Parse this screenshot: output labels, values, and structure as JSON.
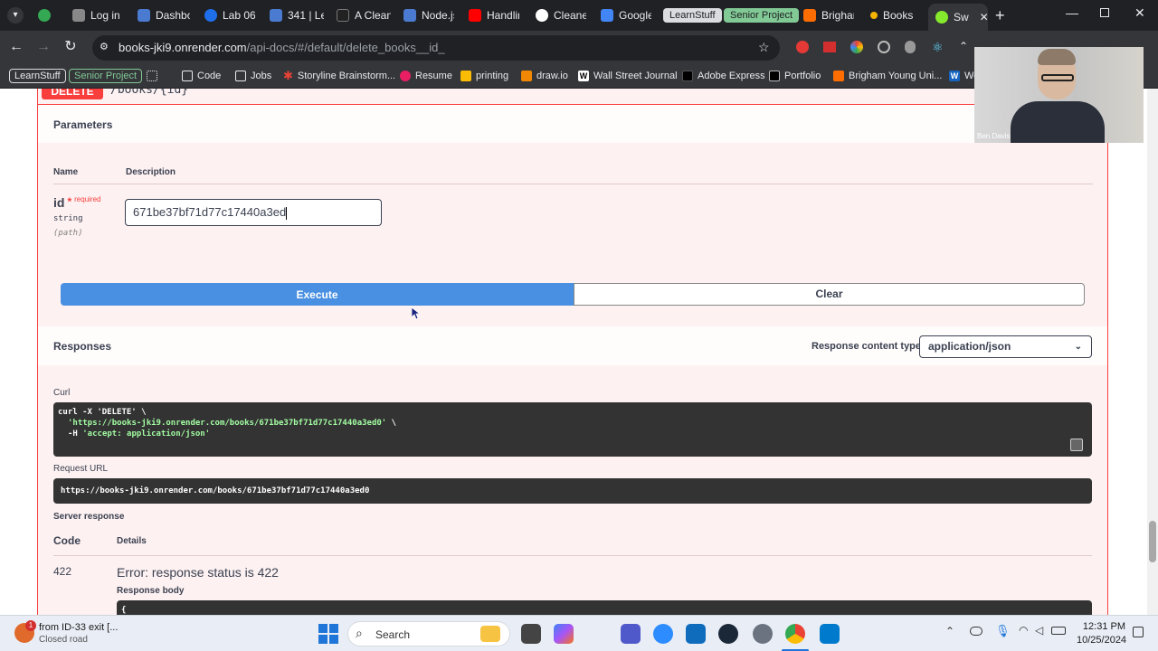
{
  "browser": {
    "tabs": [
      {
        "label": "",
        "color": "#34a853"
      },
      {
        "label": "Log in",
        "color": "#888888"
      },
      {
        "label": "Dashbo",
        "color": "#4a7bd0"
      },
      {
        "label": "Lab 06",
        "color": "#1f6feb"
      },
      {
        "label": "341 | Le",
        "color": "#4a7bd0"
      },
      {
        "label": "A Clean",
        "color": "#222222"
      },
      {
        "label": "Node.js",
        "color": "#4a7bd0"
      },
      {
        "label": "Handlin",
        "color": "#ff0000"
      },
      {
        "label": "Cleaner",
        "color": "#ffffff"
      },
      {
        "label": "Google",
        "color": "#4285f4"
      },
      {
        "label": "LearnStuff",
        "color": "#5f6368"
      },
      {
        "label": "Senior Project",
        "color": "#34a853"
      },
      {
        "label": "Brighan",
        "color": "#ff6d00"
      },
      {
        "label": "Books",
        "color": "#f4b400"
      },
      {
        "label": "Sw",
        "color": "#85ea2d"
      }
    ],
    "url_host": "books-jki9.onrender.com",
    "url_path": "/api-docs/#/default/delete_books__id_",
    "bookmarks": [
      {
        "label": "LearnStuff"
      },
      {
        "label": "Senior Project"
      },
      {
        "label": "Code"
      },
      {
        "label": "Jobs"
      },
      {
        "label": "Storyline Brainstorm..."
      },
      {
        "label": "Resume"
      },
      {
        "label": "printing"
      },
      {
        "label": "draw.io"
      },
      {
        "label": "Wall Street Journal"
      },
      {
        "label": "Adobe Express"
      },
      {
        "label": "Portfolio"
      },
      {
        "label": "Brigham Young Uni..."
      },
      {
        "label": "We"
      }
    ]
  },
  "swagger": {
    "method": "DELETE",
    "path": "/books/{id}",
    "parameters_title": "Parameters",
    "col_name": "Name",
    "col_description": "Description",
    "param_name": "id",
    "param_required_star": "*",
    "param_required": "required",
    "param_type": "string",
    "param_in": "(path)",
    "param_value": "671be37bf71d77c17440a3ed",
    "execute_label": "Execute",
    "clear_label": "Clear",
    "responses_title": "Responses",
    "content_type_label": "Response content type",
    "content_type_value": "application/json",
    "curl_label": "Curl",
    "curl_line1": "curl -X 'DELETE' \\",
    "curl_line2": "'https://books-jki9.onrender.com/books/671be37bf71d77c17440a3ed0'",
    "curl_line2_tail": " \\",
    "curl_line3_pre": "-H ",
    "curl_line3": "'accept: application/json'",
    "request_url_label": "Request URL",
    "request_url": "https://books-jki9.onrender.com/books/671be37bf71d77c17440a3ed0",
    "server_response_label": "Server response",
    "code_col": "Code",
    "details_col": "Details",
    "status_code": "422",
    "error_text": "Error: response status is 422",
    "response_body_label": "Response body",
    "response_body_start": "{"
  },
  "webcam": {
    "name": "Ben Davis"
  },
  "taskbar": {
    "notification_badge": "1",
    "weather_title": "from ID-33 exit [...",
    "weather_sub": "Closed road",
    "search_label": "Search",
    "time": "12:31 PM",
    "date": "10/25/2024"
  }
}
